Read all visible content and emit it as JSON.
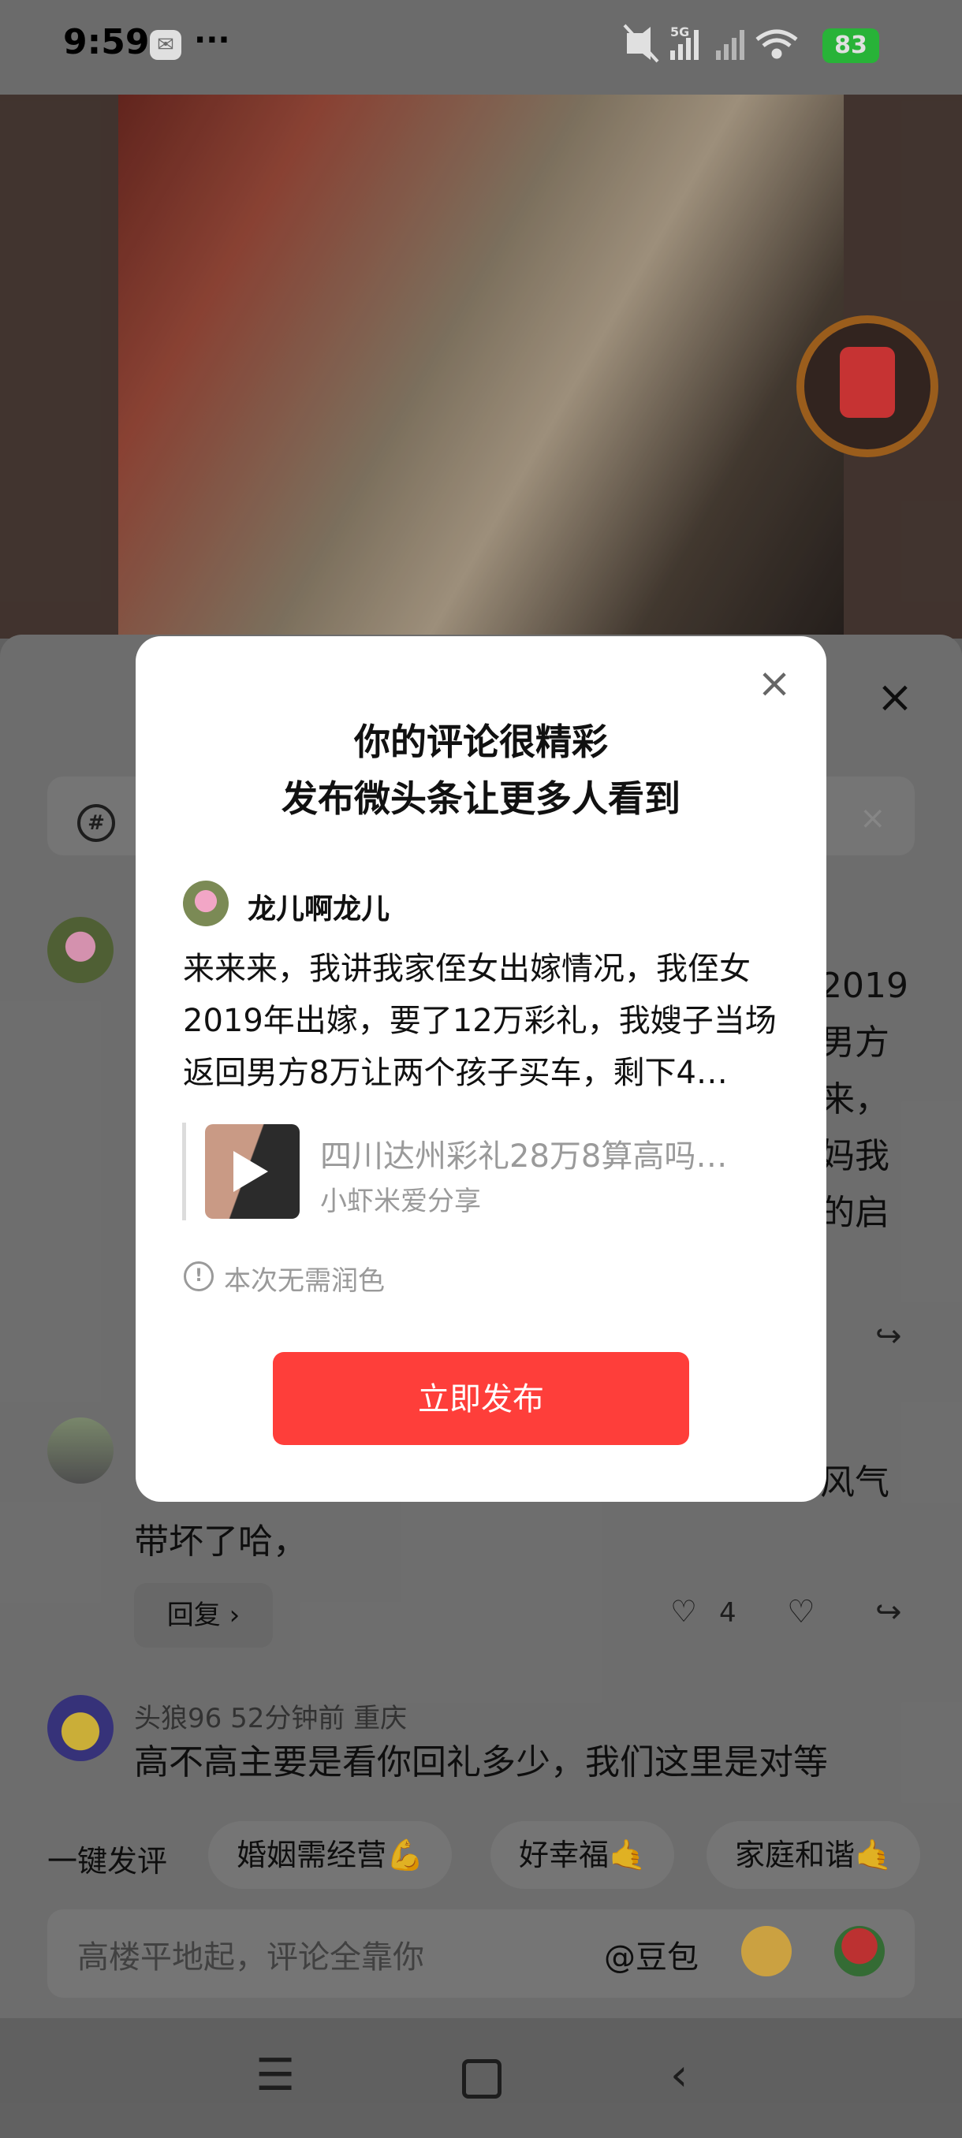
{
  "status_bar": {
    "time": "9:59",
    "signal": "5G",
    "battery": "83"
  },
  "modal": {
    "title_line1": "你的评论很精彩",
    "title_line2": "发布微头条让更多人看到",
    "username": "龙儿啊龙儿",
    "comment_text": "来来来，我讲我家侄女出嫁情况，我侄女2019年出嫁，要了12万彩礼，我嫂子当场返回男方8万让两个孩子买车，剩下4…",
    "video_title": "四川达州彩礼28万8算高吗…",
    "video_author": "小虾米爱分享",
    "info_text": "本次无需润色",
    "publish_button": "立即发布"
  },
  "background": {
    "comment1_fragments": [
      "2019",
      "男方",
      "来，",
      "妈我",
      "的启"
    ],
    "comment2_fragment": "风气",
    "comment2_text": "带坏了哈，",
    "comment2_reply": "回复 ›",
    "comment2_likes": "4",
    "comment3_meta": "头狼96   52分钟前   重庆",
    "comment3_text": "高不高主要是看你回礼多少，我们这里是对等"
  },
  "quick_reply": {
    "label": "一键发评",
    "chips": [
      "婚姻需经营💪",
      "好幸福🤙",
      "家庭和谐🤙"
    ]
  },
  "input": {
    "placeholder": "高楼平地起，评论全靠你",
    "mention": "@豆包"
  },
  "icons": {
    "close": "×",
    "like": "♡",
    "share": "↪",
    "topic": "#",
    "info": "!",
    "nav_menu": "☰",
    "nav_back": "‹"
  }
}
